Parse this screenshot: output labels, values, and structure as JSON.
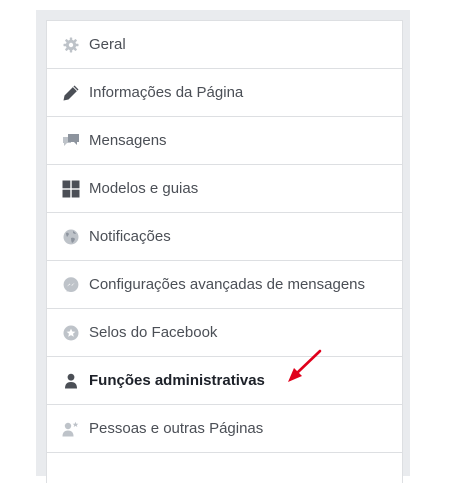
{
  "menu": {
    "items": [
      {
        "label": "Geral",
        "icon": "gear-icon"
      },
      {
        "label": "Informações da Página",
        "icon": "pencil-icon"
      },
      {
        "label": "Mensagens",
        "icon": "chat-bubbles-icon"
      },
      {
        "label": "Modelos e guias",
        "icon": "grid-icon"
      },
      {
        "label": "Notificações",
        "icon": "globe-icon"
      },
      {
        "label": "Configurações avançadas de mensagens",
        "icon": "messenger-icon"
      },
      {
        "label": "Selos do Facebook",
        "icon": "badge-icon"
      },
      {
        "label": "Funções administrativas",
        "icon": "person-icon",
        "active": true
      },
      {
        "label": "Pessoas e outras Páginas",
        "icon": "person-star-icon"
      },
      {
        "label": ""
      }
    ]
  },
  "colors": {
    "panel_bg": "#e9ebee",
    "icon_gray": "#bec3c9",
    "text": "#4b4f56",
    "active_text": "#1d2129",
    "annotation_arrow": "#e0001b"
  }
}
